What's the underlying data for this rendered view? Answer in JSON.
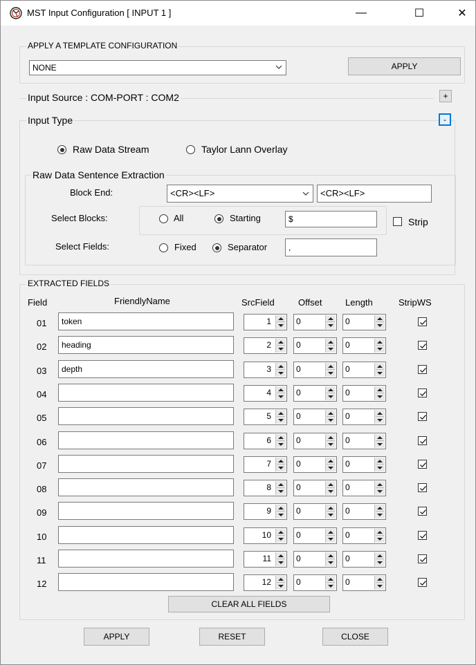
{
  "window": {
    "title": "MST Input Configuration [ INPUT 1 ]",
    "minimize": "—",
    "maximize": "☐",
    "close": "✕"
  },
  "template": {
    "legend": "APPLY A TEMPLATE CONFIGURATION",
    "selected": "NONE",
    "apply_label": "APPLY"
  },
  "input_source": {
    "label": "Input Source : COM-PORT : COM2",
    "expand_label": "+"
  },
  "input_type": {
    "legend": "Input Type",
    "collapse_label": "-",
    "options": [
      "Raw Data Stream",
      "Taylor Lann Overlay"
    ],
    "selected": "Raw Data Stream"
  },
  "raw_extraction": {
    "legend": "Raw Data Sentence Extraction",
    "block_end_label": "Block End:",
    "block_end_selected": "<CR><LF>",
    "block_end_value": "<CR><LF>",
    "select_blocks_label": "Select Blocks:",
    "blocks_all": "All",
    "blocks_starting": "Starting",
    "blocks_selected": "Starting",
    "starting_value": "$",
    "strip_label": "Strip",
    "strip_checked": false,
    "select_fields_label": "Select Fields:",
    "fields_fixed": "Fixed",
    "fields_separator": "Separator",
    "fields_selected": "Separator",
    "separator_value": ","
  },
  "extracted": {
    "legend": "EXTRACTED FIELDS",
    "headers": {
      "field": "Field",
      "friendly": "FriendlyName",
      "src": "SrcField",
      "offset": "Offset",
      "length": "Length",
      "strip": "StripWS"
    },
    "rows": [
      {
        "field": "01",
        "name": "token",
        "src": "1",
        "offset": "0",
        "length": "0",
        "strip": true
      },
      {
        "field": "02",
        "name": "heading",
        "src": "2",
        "offset": "0",
        "length": "0",
        "strip": true
      },
      {
        "field": "03",
        "name": "depth",
        "src": "3",
        "offset": "0",
        "length": "0",
        "strip": true
      },
      {
        "field": "04",
        "name": "",
        "src": "4",
        "offset": "0",
        "length": "0",
        "strip": true
      },
      {
        "field": "05",
        "name": "",
        "src": "5",
        "offset": "0",
        "length": "0",
        "strip": true
      },
      {
        "field": "06",
        "name": "",
        "src": "6",
        "offset": "0",
        "length": "0",
        "strip": true
      },
      {
        "field": "07",
        "name": "",
        "src": "7",
        "offset": "0",
        "length": "0",
        "strip": true
      },
      {
        "field": "08",
        "name": "",
        "src": "8",
        "offset": "0",
        "length": "0",
        "strip": true
      },
      {
        "field": "09",
        "name": "",
        "src": "9",
        "offset": "0",
        "length": "0",
        "strip": true
      },
      {
        "field": "10",
        "name": "",
        "src": "10",
        "offset": "0",
        "length": "0",
        "strip": true
      },
      {
        "field": "11",
        "name": "",
        "src": "11",
        "offset": "0",
        "length": "0",
        "strip": true
      },
      {
        "field": "12",
        "name": "",
        "src": "12",
        "offset": "0",
        "length": "0",
        "strip": true
      }
    ],
    "clear_all_label": "CLEAR ALL FIELDS"
  },
  "footer": {
    "apply_label": "APPLY",
    "reset_label": "RESET",
    "close_label": "CLOSE"
  }
}
